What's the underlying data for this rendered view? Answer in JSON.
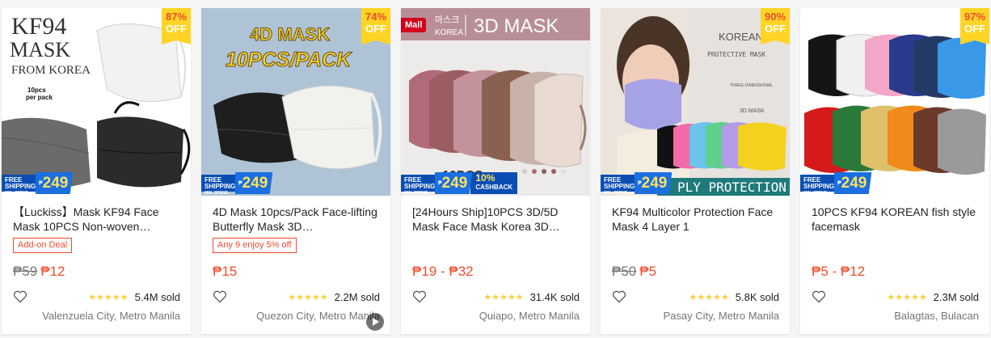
{
  "products": [
    {
      "title": "【Luckiss】Mask KF94 Face Mask 10PCS Non-woven…",
      "discount_pct": "87%",
      "discount_off": "OFF",
      "image_text": [
        "KF94",
        "MASK",
        "FROM KOREA",
        "10pcs",
        "per pack"
      ],
      "tag": "Add-on Deal",
      "old_price": "₱59",
      "price": "₱12",
      "stars": "★★★★★",
      "sold": "5.4M sold",
      "location": "Valenzuela City, Metro Manila"
    },
    {
      "title": "4D Mask 10pcs/Pack Face-lifting Butterfly Mask 3D…",
      "discount_pct": "74%",
      "discount_off": "OFF",
      "image_text": [
        "4D MASK",
        "10PCS/PACK"
      ],
      "tag": "Any 9 enjoy 5% off",
      "old_price": "",
      "price": "₱15",
      "stars": "★★★★★",
      "sold": "2.2M sold",
      "location": "Quezon City, Metro Manila"
    },
    {
      "title": "[24Hours Ship]10PCS 3D/5D Mask Face Mask Korea 3D…",
      "mall": "Mall",
      "image_text": [
        "마스크",
        "KOREA",
        "3D MASK",
        "10PCS"
      ],
      "cashback_pct": "10%",
      "cashback_label": "CASHBACK",
      "old_price": "",
      "price": "₱19 - ₱32",
      "stars": "★★★★★",
      "sold": "31.4K sold",
      "location": "Quiapo, Metro Manila"
    },
    {
      "title": "KF94 Multicolor Protection Face Mask 4 Layer 1",
      "discount_pct": "90%",
      "discount_off": "OFF",
      "image_text": [
        "KOREAN",
        "PROTECTIVE MASK",
        "THREE-DIMENSIONAL",
        "3D MASK",
        "PLY PROTECTION"
      ],
      "old_price": "₱50",
      "price": "₱5",
      "stars": "★★★★★",
      "sold": "5.8K sold",
      "location": "Pasay City, Metro Manila"
    },
    {
      "title": "10PCS KF94 KOREAN fish style facemask",
      "discount_pct": "97%",
      "discount_off": "OFF",
      "old_price": "",
      "price": "₱5 - ₱12",
      "stars": "★★★★★",
      "sold": "2.3M sold",
      "location": "Balagtas, Bulacan"
    }
  ],
  "free_shipping": {
    "line1": "FREE",
    "line2": "SHIPPING",
    "line3": "MIN. SPEND",
    "currency": "₱",
    "amount": "249"
  },
  "colors": {
    "price": "#ee4d2d",
    "discount_bg": "#ffd424",
    "mall": "#d0011b",
    "star": "#ffce3d",
    "free_shipping": "#0a4eb3"
  }
}
